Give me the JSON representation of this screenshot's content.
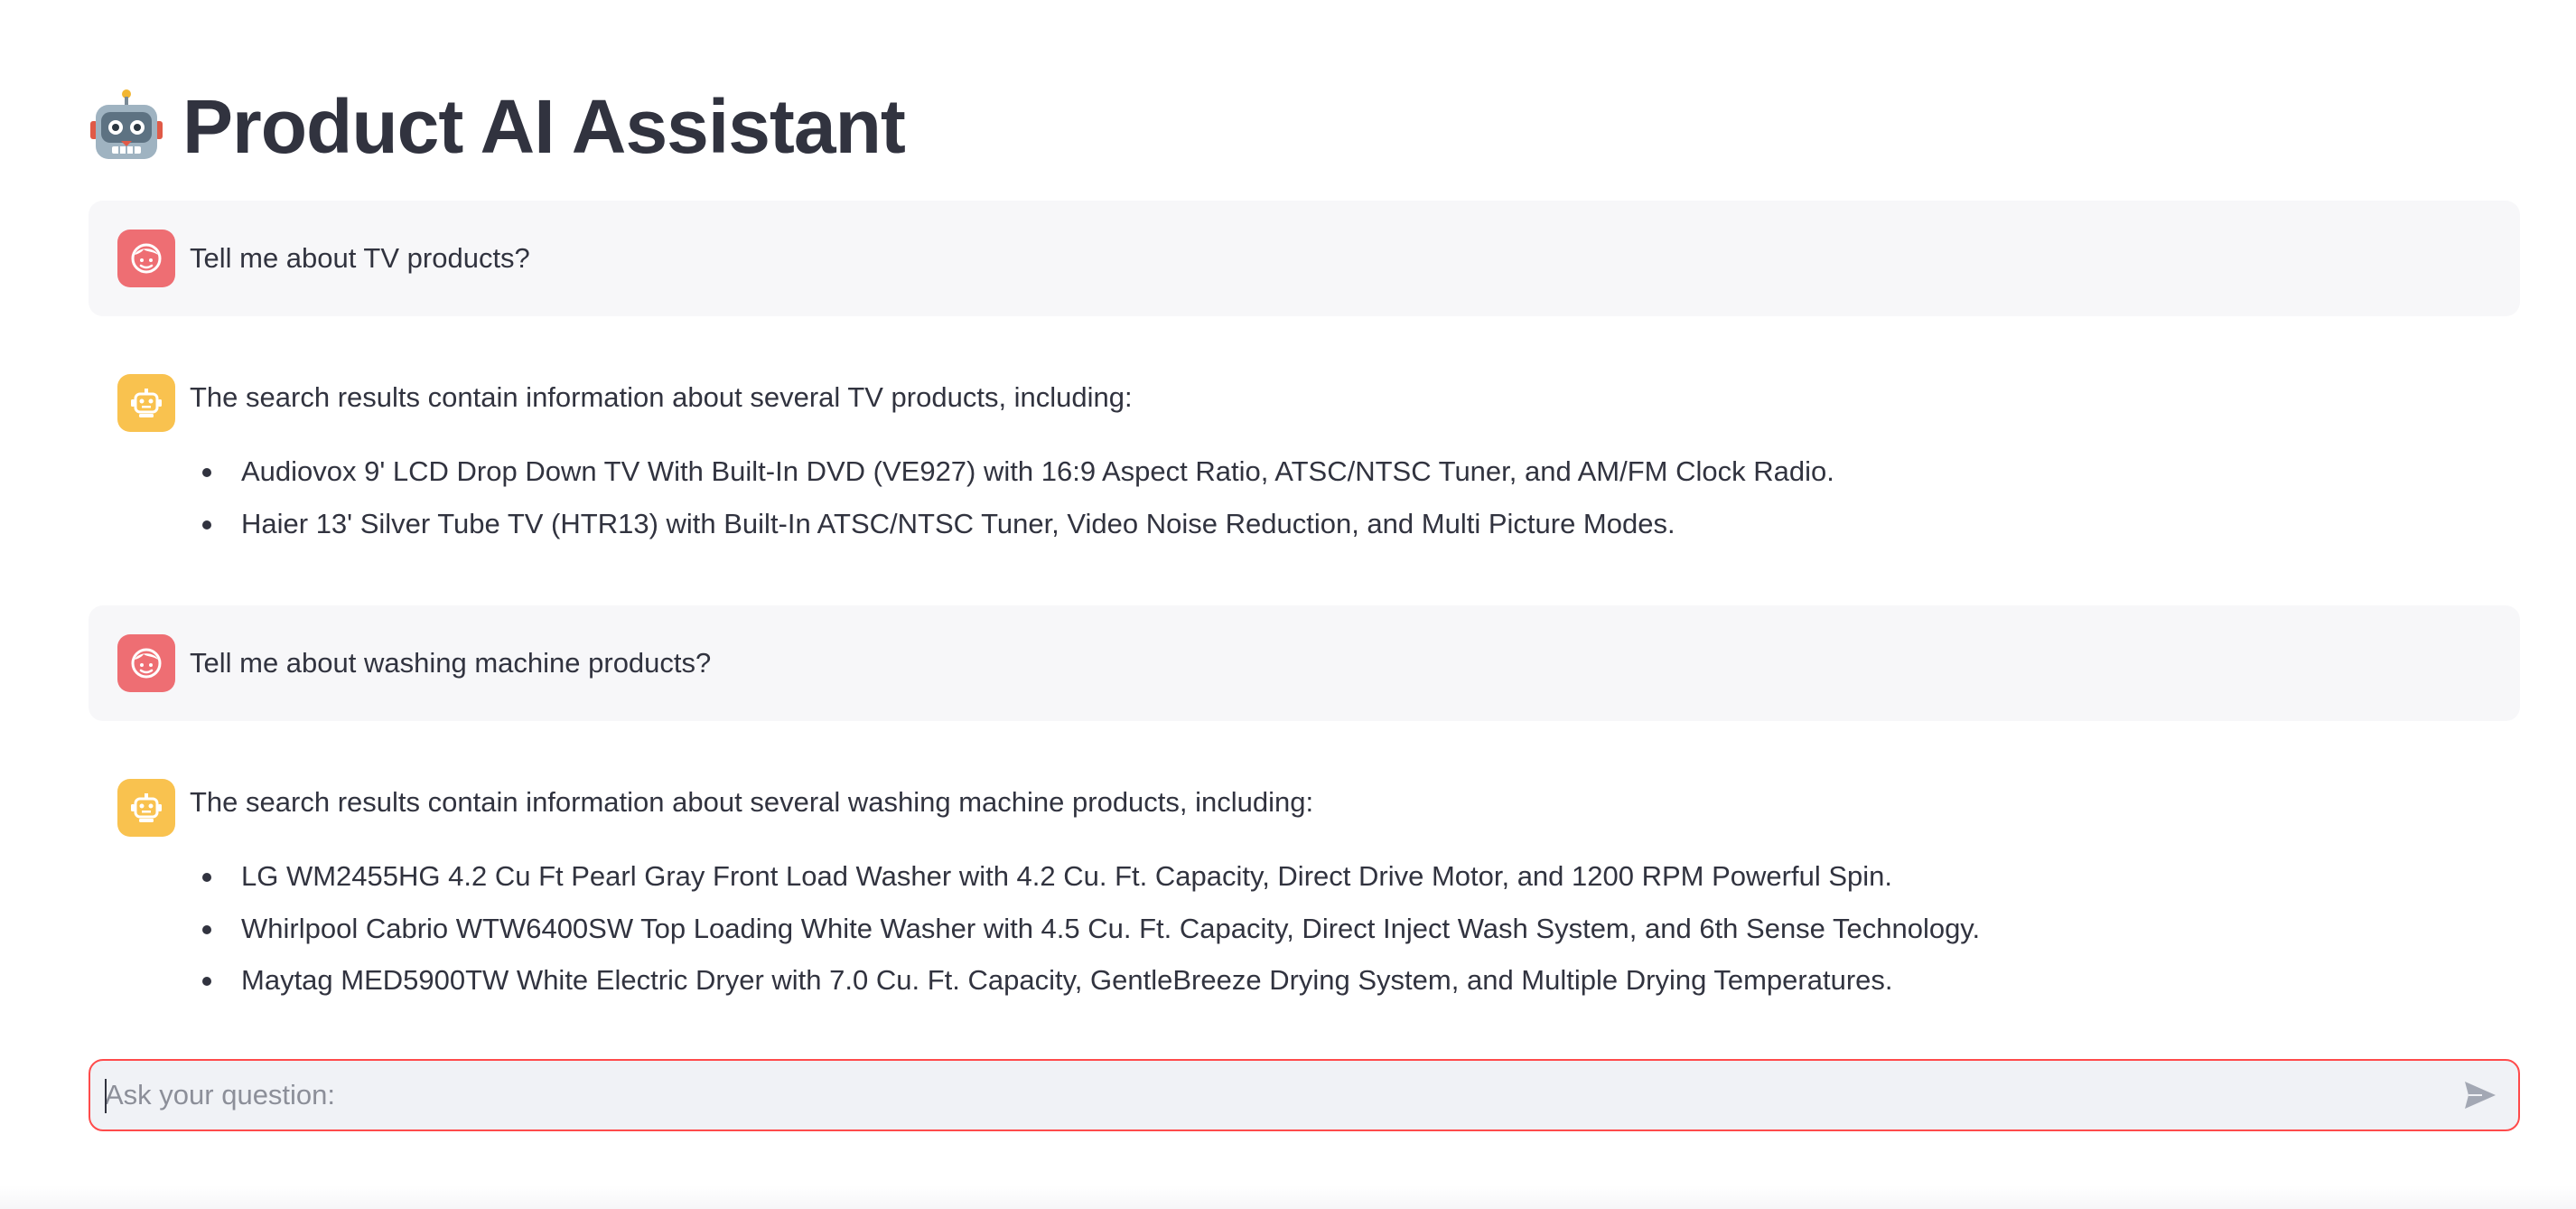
{
  "app": {
    "title_icon": "robot-emoji-icon",
    "title": "Product AI Assistant"
  },
  "messages": [
    {
      "role": "user",
      "avatar_icon": "user-face-icon",
      "text": "Tell me about TV products?"
    },
    {
      "role": "assistant",
      "avatar_icon": "robot-icon",
      "text": "The search results contain information about several TV products, including:",
      "bullets": [
        "Audiovox 9' LCD Drop Down TV With Built-In DVD (VE927) with 16:9 Aspect Ratio, ATSC/NTSC Tuner, and AM/FM Clock Radio.",
        "Haier 13' Silver Tube TV (HTR13) with Built-In ATSC/NTSC Tuner, Video Noise Reduction, and Multi Picture Modes."
      ]
    },
    {
      "role": "user",
      "avatar_icon": "user-face-icon",
      "text": "Tell me about washing machine products?"
    },
    {
      "role": "assistant",
      "avatar_icon": "robot-icon",
      "text": "The search results contain information about several washing machine products, including:",
      "bullets": [
        "LG WM2455HG 4.2 Cu Ft Pearl Gray Front Load Washer with 4.2 Cu. Ft. Capacity, Direct Drive Motor, and 1200 RPM Powerful Spin.",
        "Whirlpool Cabrio WTW6400SW Top Loading White Washer with 4.5 Cu. Ft. Capacity, Direct Inject Wash System, and 6th Sense Technology.",
        "Maytag MED5900TW White Electric Dryer with 7.0 Cu. Ft. Capacity, GentleBreeze Drying System, and Multiple Drying Temperatures."
      ]
    }
  ],
  "chat_input": {
    "value": "",
    "placeholder": "Ask your question:",
    "send_icon": "send-icon"
  },
  "colors": {
    "user_avatar": "#ee6e73",
    "assistant_avatar": "#f9c24f",
    "input_focus_border": "#ff4b4b",
    "text": "#31333f"
  }
}
